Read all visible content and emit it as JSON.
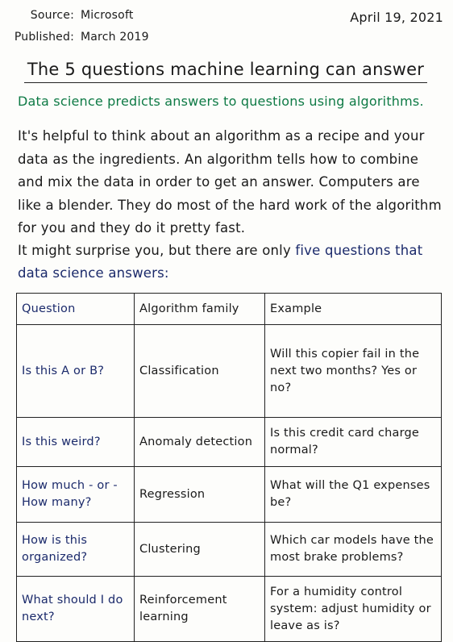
{
  "meta": {
    "source_label": "Source:",
    "source_value": "Microsoft",
    "published_label": "Published:",
    "published_value": "March 2019",
    "date": "April 19, 2021"
  },
  "title": "The 5 questions machine learning can answer",
  "subtitle": "Data science predicts answers to questions using algorithms.",
  "intro": "It's helpful to think about an algorithm as a recipe and your data as the ingredients. An algorithm tells how to combine and mix the data in order to get an answer. Computers are like a blender. They do most of the hard work of the algorithm for you and they do it pretty fast.",
  "intro2": {
    "lead": "It might surprise you, but there are only ",
    "emphasis": "five questions that data science answers:"
  },
  "table": {
    "headers": [
      "Question",
      "Algorithm family",
      "Example"
    ],
    "rows": [
      {
        "question": "Is this A or B?",
        "family": "Classification",
        "example": "Will this copier fail in the next two months? Yes or no?"
      },
      {
        "question": "Is this weird?",
        "family": "Anomaly detection",
        "example": "Is this credit card charge normal?"
      },
      {
        "question": "How much - or - How many?",
        "family": "Regression",
        "example": "What will the Q1 expenses be?"
      },
      {
        "question": "How is this organized?",
        "family": "Clustering",
        "example": "Which car models have the most brake problems?"
      },
      {
        "question": "What should I do next?",
        "family": "Reinforcement learning",
        "example": "For a humidity control system: adjust humidity or leave as is?"
      }
    ]
  },
  "colors": {
    "subtitle": "#0e7a45",
    "question_ink": "#1b2a6b",
    "ink": "#1a1a1a"
  }
}
